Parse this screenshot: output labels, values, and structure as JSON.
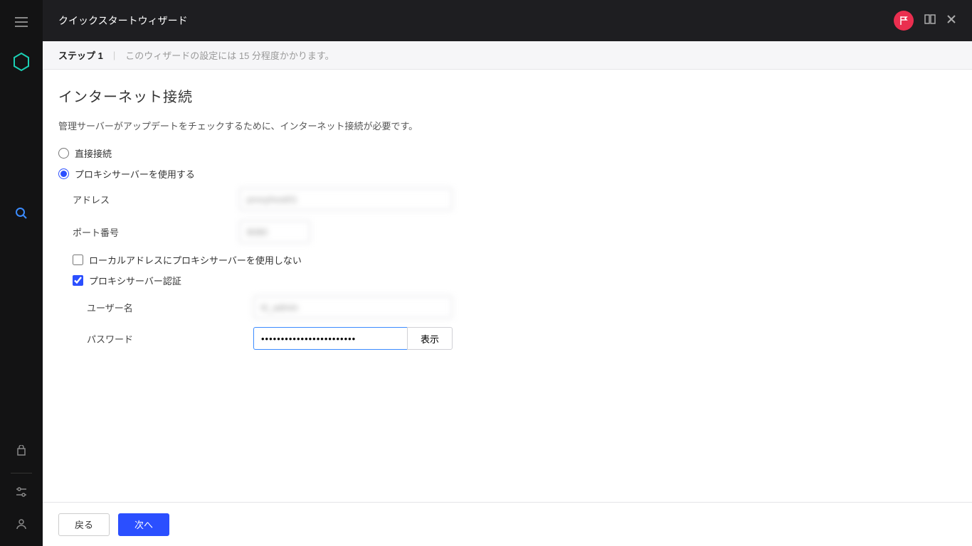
{
  "topbar": {
    "title": "クイックスタートウィザード"
  },
  "stepbar": {
    "step": "ステップ 1",
    "desc": "このウィザードの設定には 15 分程度かかります。"
  },
  "content": {
    "heading": "インターネット接続",
    "desc": "管理サーバーがアップデートをチェックするために、インターネット接続が必要です。",
    "radio_direct": "直接接続",
    "radio_proxy": "プロキシサーバーを使用する",
    "label_address": "アドレス",
    "value_address": "proxyhost01",
    "label_port": "ポート番号",
    "value_port": "8080",
    "check_bypass": "ローカルアドレスにプロキシサーバーを使用しない",
    "check_auth": "プロキシサーバー認証",
    "label_user": "ユーザー名",
    "value_user": "kl_admin",
    "label_password": "パスワード",
    "value_password": "••••••••••••••••••••••••",
    "show_btn": "表示"
  },
  "footer": {
    "back": "戻る",
    "next": "次へ"
  }
}
